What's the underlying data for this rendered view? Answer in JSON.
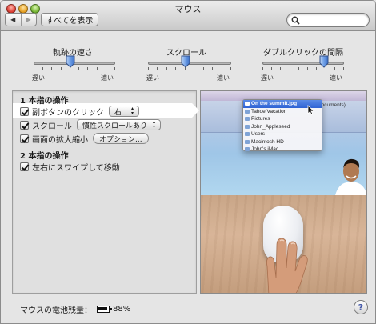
{
  "window": {
    "title": "マウス"
  },
  "toolbar": {
    "back": "◀",
    "forward": "▶",
    "show_all": "すべてを表示",
    "search_value": "",
    "search_placeholder": ""
  },
  "sliders": [
    {
      "label": "軌跡の速さ",
      "min": "遅い",
      "max": "速い",
      "value": 0.45
    },
    {
      "label": "スクロール",
      "min": "遅い",
      "max": "速い",
      "value": 0.45
    },
    {
      "label": "ダブルクリックの間隔",
      "min": "遅い",
      "max": "速い",
      "value": 0.75
    }
  ],
  "one_finger": {
    "heading": "1 本指の操作",
    "secondary_click": {
      "label": "副ボタンのクリック",
      "checked": true,
      "value": "右"
    },
    "scroll": {
      "label": "スクロール",
      "checked": true,
      "value": "慣性スクロールあり"
    },
    "zoom": {
      "label": "画面の拡大縮小",
      "checked": true,
      "button": "オプション..."
    }
  },
  "two_finger": {
    "heading": "2 本指の操作",
    "swipe": {
      "label": "左右にスワイプして移動",
      "checked": true
    }
  },
  "preview": {
    "menu_items": [
      "On the summit.jpg",
      "Tahoe Vacation",
      "Pictures",
      "John_Appleseed",
      "Users",
      "Macintosh HD",
      "John's iMac"
    ],
    "behind_text": "documents)"
  },
  "battery": {
    "label": "マウスの電池残量：",
    "level": "88%"
  },
  "help": {
    "label": "?"
  },
  "colors": {
    "selection": "#2f63d4",
    "help_glyph": "#4055a8"
  }
}
